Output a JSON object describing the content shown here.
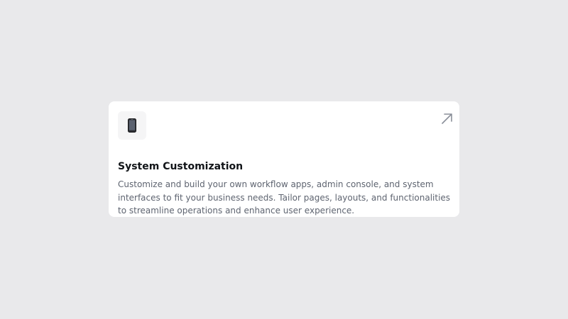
{
  "card": {
    "icon": "smartphone-icon",
    "action_icon": "arrow-up-right-icon",
    "title": "System Customization",
    "description": "Customize and build your own workflow apps, admin console, and system interfaces to fit your business needs. Tailor pages, layouts, and functionalities to streamline operations and enhance user experience."
  },
  "colors": {
    "page_background": "#e9e9eb",
    "card_background": "#ffffff",
    "title": "#111418",
    "description": "#5e6470",
    "arrow": "#8a8f99"
  }
}
